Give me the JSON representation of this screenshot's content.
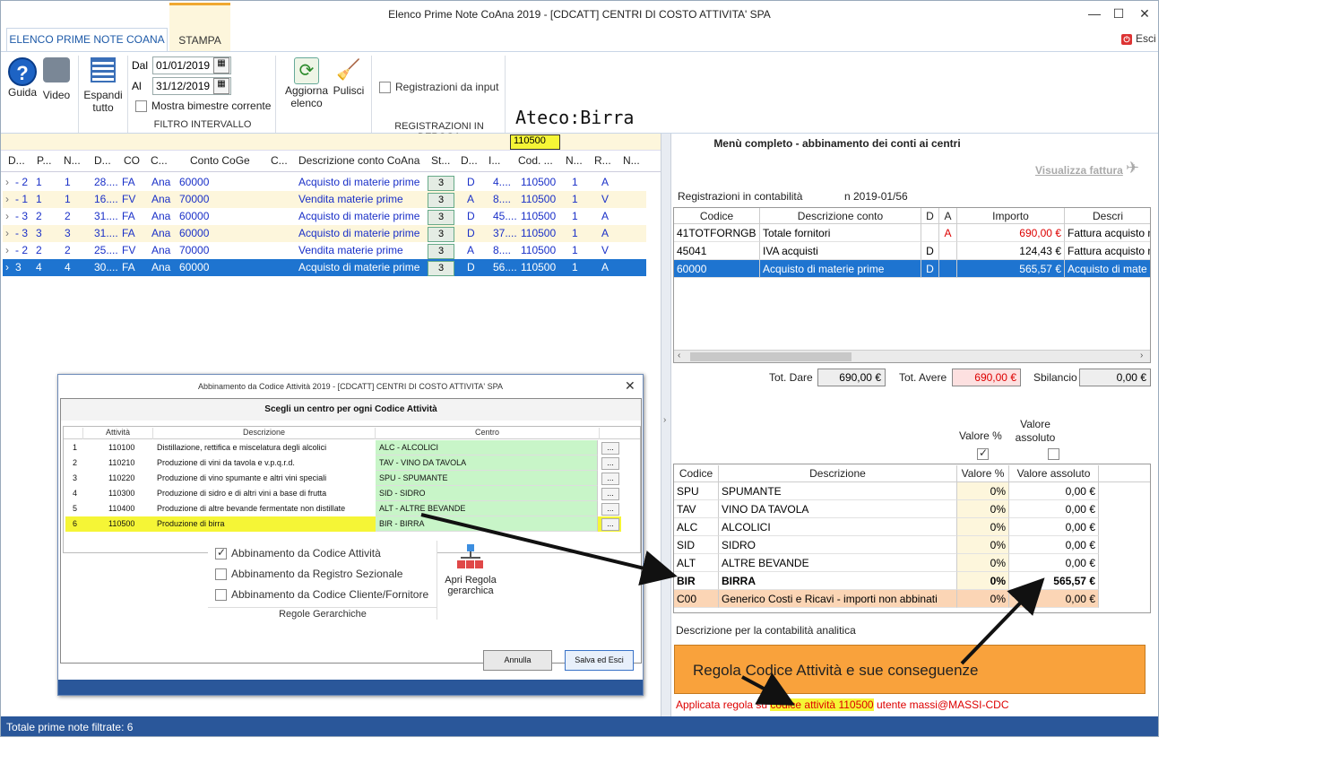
{
  "window": {
    "title": "Elenco Prime Note CoAna 2019 - [CDCATT] CENTRI DI COSTO ATTIVITA' SPA",
    "min": "—",
    "max": "☐",
    "close": "✕"
  },
  "tabs": [
    "ELENCO PRIME NOTE COANA",
    "STAMPA"
  ],
  "esci": "Esci",
  "ribbon": {
    "guida": "Guida",
    "video": "Video",
    "espandi": "Espandi",
    "tutto": "tutto",
    "dal_label": "Dal",
    "dal": "01/01/2019",
    "al_label": "Al",
    "al": "31/12/2019",
    "mostra": "Mostra bimestre corrente",
    "filtro_group": "FILTRO INTERVALLO",
    "aggiorna": "Aggiorna",
    "elenco": "elenco",
    "pulisci": "Pulisci",
    "reg_input": "Registrazioni da input",
    "reg_group": "REGISTRAZIONI IN DEROGA"
  },
  "ateco": "Ateco:Birra",
  "filter_value": "110500",
  "grid": {
    "headers": [
      "D...",
      "P...",
      "N...",
      "D...",
      "CO",
      "C...",
      "Conto CoGe",
      "C...",
      "Descrizione conto CoAna",
      "St...",
      "D...",
      "I...",
      "Cod. ...",
      "N...",
      "R...",
      "N..."
    ],
    "rows": [
      [
        "- 2",
        "1",
        "1",
        "28....",
        "FA",
        "Ana",
        "60000",
        "Acquisto di materie prime",
        "3",
        "D",
        "4....",
        "110500",
        "1",
        "A"
      ],
      [
        "- 1",
        "1",
        "1",
        "16....",
        "FV",
        "Ana",
        "70000",
        "Vendita materie prime",
        "3",
        "A",
        "8....",
        "110500",
        "1",
        "V"
      ],
      [
        "- 3",
        "2",
        "2",
        "31....",
        "FA",
        "Ana",
        "60000",
        "Acquisto di materie prime",
        "3",
        "D",
        "45....",
        "110500",
        "1",
        "A"
      ],
      [
        "- 3",
        "3",
        "3",
        "31....",
        "FA",
        "Ana",
        "60000",
        "Acquisto di materie prime",
        "3",
        "D",
        "37....",
        "110500",
        "1",
        "A"
      ],
      [
        "- 2",
        "2",
        "2",
        "25....",
        "FV",
        "Ana",
        "70000",
        "Vendita materie prime",
        "3",
        "A",
        "8....",
        "110500",
        "1",
        "V"
      ],
      [
        "3",
        "4",
        "4",
        "30....",
        "FA",
        "Ana",
        "60000",
        "Acquisto di materie prime",
        "3",
        "D",
        "56....",
        "110500",
        "1",
        "A"
      ]
    ]
  },
  "right": {
    "title": "Menù completo - abbinamento dei conti ai centri",
    "visualizza": "Visualizza fattura",
    "reg_label": "Registrazioni in contabilità",
    "reg_num": "n 2019-01/56",
    "acc_headers": [
      "Codice",
      "Descrizione conto",
      "D",
      "A",
      "Importo",
      "Descri"
    ],
    "acc_rows": [
      [
        "41TOTFORNGB",
        "Totale fornitori",
        "",
        "A",
        "690,00 €",
        "Fattura acquisto n"
      ],
      [
        "45041",
        "IVA acquisti",
        "D",
        "",
        "124,43 €",
        "Fattura acquisto n"
      ],
      [
        "60000",
        "Acquisto di materie prime",
        "D",
        "",
        "565,57 €",
        "Acquisto di mate"
      ]
    ],
    "tot_dare_label": "Tot. Dare",
    "tot_dare": "690,00 €",
    "tot_avere_label": "Tot. Avere",
    "tot_avere": "690,00 €",
    "sbil_label": "Sbilancio",
    "sbil": "0,00 €",
    "valore_pct": "Valore %",
    "valore_ass_1": "Valore",
    "valore_ass_2": "assoluto",
    "ctr_headers": [
      "Codice",
      "Descrizione",
      "Valore %",
      "Valore assoluto"
    ],
    "ctr_rows": [
      [
        "SPU",
        "SPUMANTE",
        "0%",
        "0,00 €"
      ],
      [
        "TAV",
        "VINO DA TAVOLA",
        "0%",
        "0,00 €"
      ],
      [
        "ALC",
        "ALCOLICI",
        "0%",
        "0,00 €"
      ],
      [
        "SID",
        "SIDRO",
        "0%",
        "0,00 €"
      ],
      [
        "ALT",
        "ALTRE BEVANDE",
        "0%",
        "0,00 €"
      ],
      [
        "BIR",
        "BIRRA",
        "0%",
        "565,57 €"
      ],
      [
        "C00",
        "Generico Costi e Ricavi - importi non abbinati",
        "0%",
        "0,00 €"
      ]
    ],
    "desc_label": "Descrizione per la contabilità analitica",
    "banner": "Regola Codice Attività e sue conseguenze",
    "applied_pre": "Applicata regola su ",
    "applied_hl": "codice attività 110500",
    "applied_post": " utente massi@MASSI-CDC"
  },
  "status": "Totale prime note filtrate: 6",
  "dialog": {
    "title": "Abbinamento da Codice Attività 2019 - [CDCATT] CENTRI DI COSTO ATTIVITA' SPA",
    "close": "✕",
    "heading": "Scegli un centro per ogni Codice Attività",
    "headers": [
      "Attività",
      "Descrizione",
      "Centro"
    ],
    "rows": [
      [
        "1",
        "110100",
        "Distillazione, rettifica e miscelatura degli alcolici",
        "ALC - ALCOLICI"
      ],
      [
        "2",
        "110210",
        "Produzione di vini da tavola e v.p.q.r.d.",
        "TAV - VINO DA TAVOLA"
      ],
      [
        "3",
        "110220",
        "Produzione di vino spumante e altri vini speciali",
        "SPU - SPUMANTE"
      ],
      [
        "4",
        "110300",
        "Produzione di sidro e di altri vini a base di frutta",
        "SID - SIDRO"
      ],
      [
        "5",
        "110400",
        "Produzione di altre bevande fermentate non distillate",
        "ALT - ALTRE BEVANDE"
      ],
      [
        "6",
        "110500",
        "Produzione di birra",
        "BIR - BIRRA"
      ]
    ],
    "dots": "...",
    "opt1": "Abbinamento da Codice Attività",
    "opt2": "Abbinamento da Registro Sezionale",
    "opt3": "Abbinamento da Codice Cliente/Fornitore",
    "rules_group": "Regole Gerarchiche",
    "apri1": "Apri Regola",
    "apri2": "gerarchica",
    "annulla": "Annulla",
    "salva": "Salva ed Esci"
  }
}
